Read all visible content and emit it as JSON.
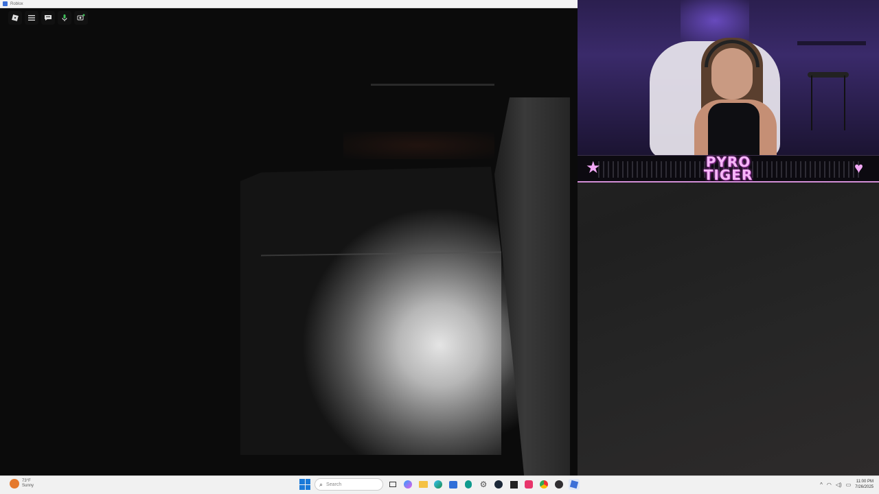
{
  "window": {
    "title": "Roblox"
  },
  "roblox_menu": {
    "buttons": [
      {
        "name": "roblox-logo-button",
        "icon": "roblox-logo-icon",
        "glyph": "◆"
      },
      {
        "name": "menu-button",
        "icon": "hamburger-icon",
        "glyph": "☰"
      },
      {
        "name": "chat-button",
        "icon": "chat-icon",
        "glyph": "▤"
      },
      {
        "name": "mic-button",
        "icon": "microphone-icon",
        "glyph": "🎙"
      },
      {
        "name": "camera-button",
        "icon": "camera-icon",
        "glyph": "⚙"
      }
    ]
  },
  "webcam": {
    "brand_line1": "PYRO",
    "brand_line2": "TIGER",
    "accent_color": "#f2a8f6"
  },
  "taskbar": {
    "weather_temp": "73°F",
    "weather_desc": "Sunny",
    "search_placeholder": "Search",
    "clock_time": "11:00 PM",
    "clock_date": "7/26/2025"
  }
}
